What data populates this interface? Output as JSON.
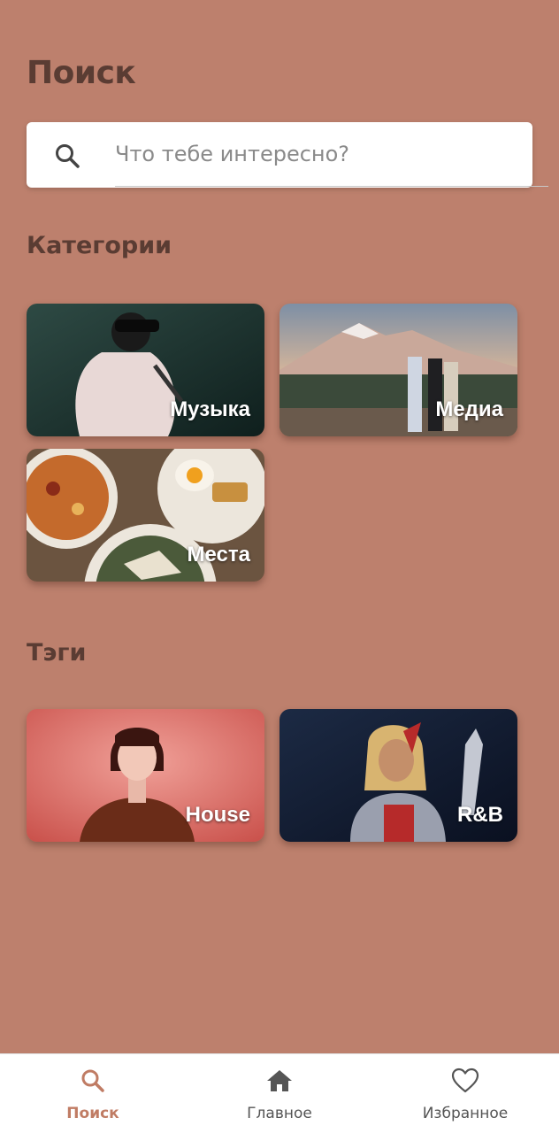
{
  "header": {
    "title": "Поиск"
  },
  "search": {
    "placeholder": "Что тебе интересно?"
  },
  "categories": {
    "title": "Категории",
    "items": [
      {
        "label": "Музыка"
      },
      {
        "label": "Медиа"
      },
      {
        "label": "Места"
      }
    ]
  },
  "tags": {
    "title": "Тэги",
    "items": [
      {
        "label": "House"
      },
      {
        "label": "R&B"
      }
    ]
  },
  "bottom_nav": {
    "items": [
      {
        "label": "Поиск",
        "icon": "search-icon",
        "active": true
      },
      {
        "label": "Главное",
        "icon": "home-icon",
        "active": false
      },
      {
        "label": "Избранное",
        "icon": "heart-icon",
        "active": false
      }
    ]
  },
  "colors": {
    "background": "#bd806d",
    "title": "#5a3c33",
    "accent": "#c07c64"
  }
}
